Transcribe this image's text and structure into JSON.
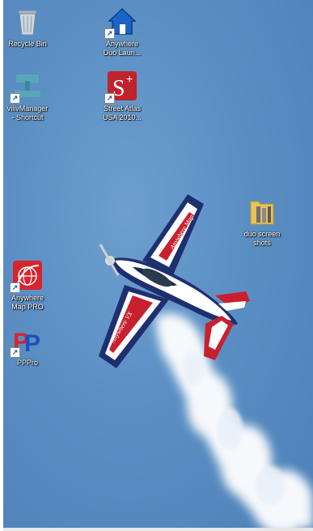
{
  "desktop": {
    "icons": [
      {
        "name": "recycle-bin",
        "label": "Recycle Bin",
        "icon": "recycle-bin-icon"
      },
      {
        "name": "anywhere-duo-launcher",
        "label": "Anywhere\nDuo Laun...",
        "icon": "house-icon"
      },
      {
        "name": "vilivmanager-shortcut",
        "label": "vilivManager\n- Shortcut",
        "icon": "manager-icon"
      },
      {
        "name": "street-atlas-usa",
        "label": "Street Atlas\nUSA 2010...",
        "icon": "s-plus-icon"
      },
      {
        "name": "duo-screen-shots",
        "label": "duo screen\nshots",
        "icon": "folder-icon"
      },
      {
        "name": "anywhere-map-pro",
        "label": "Anywhere\nMap PRO",
        "icon": "globe-icon"
      },
      {
        "name": "pppro",
        "label": "PPPro",
        "icon": "pp-logo-icon"
      }
    ]
  },
  "wallpaper": {
    "plane_text_wing_top": "Anywhere Map",
    "plane_text_wing_bottom": "Anywhere VX",
    "plane_text_tail": "N",
    "sky_color": "#5b8fc4",
    "smoke_color": "#ffffff"
  }
}
